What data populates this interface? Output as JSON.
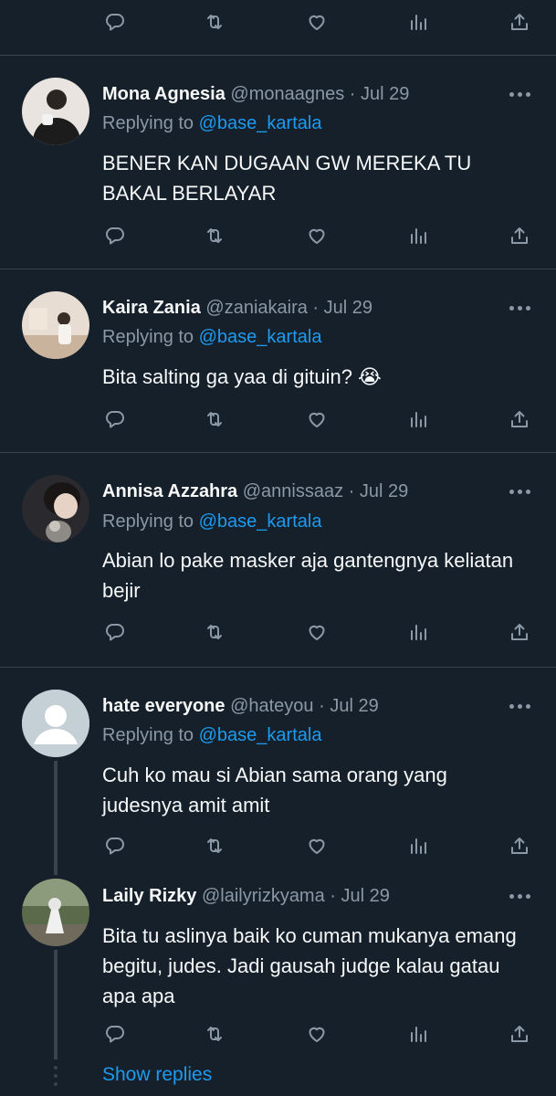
{
  "tweets": [
    {
      "name": "Mona Agnesia",
      "handle": "@monaagnes",
      "date": "Jul 29",
      "replying_prefix": "Replying to ",
      "replying_to": "@base_kartala",
      "text": "BENER KAN DUGAAN GW MEREKA TU BAKAL BERLAYAR"
    },
    {
      "name": "Kaira Zania",
      "handle": "@zaniakaira",
      "date": "Jul 29",
      "replying_prefix": "Replying to ",
      "replying_to": "@base_kartala",
      "text": "Bita salting ga yaa di gituin?",
      "emoji": "😭"
    },
    {
      "name": "Annisa Azzahra",
      "handle": "@annissaaz",
      "date": "Jul 29",
      "replying_prefix": "Replying to ",
      "replying_to": "@base_kartala",
      "text": "Abian lo pake masker aja gantengnya keliatan bejir"
    },
    {
      "name": "hate everyone",
      "handle": "@hateyou",
      "date": "Jul 29",
      "replying_prefix": "Replying to ",
      "replying_to": "@base_kartala",
      "text": "Cuh ko mau si Abian sama orang yang judesnya amit amit"
    },
    {
      "name": "Laily Rizky",
      "handle": "@lailyrizkyama",
      "date": "Jul 29",
      "text": "Bita tu aslinya baik ko cuman mukanya emang begitu, judes. Jadi gausah judge kalau gatau apa apa"
    }
  ],
  "separator": " · ",
  "show_replies": "Show replies",
  "icons": [
    "reply-icon",
    "retweet-icon",
    "like-icon",
    "analytics-icon",
    "share-icon",
    "more-icon",
    "default-avatar-icon"
  ],
  "colors": {
    "background": "#15202b",
    "text": "#f7f9f9",
    "secondary": "#8b98a5",
    "link": "#1d9bf0",
    "divider": "#38444d"
  }
}
